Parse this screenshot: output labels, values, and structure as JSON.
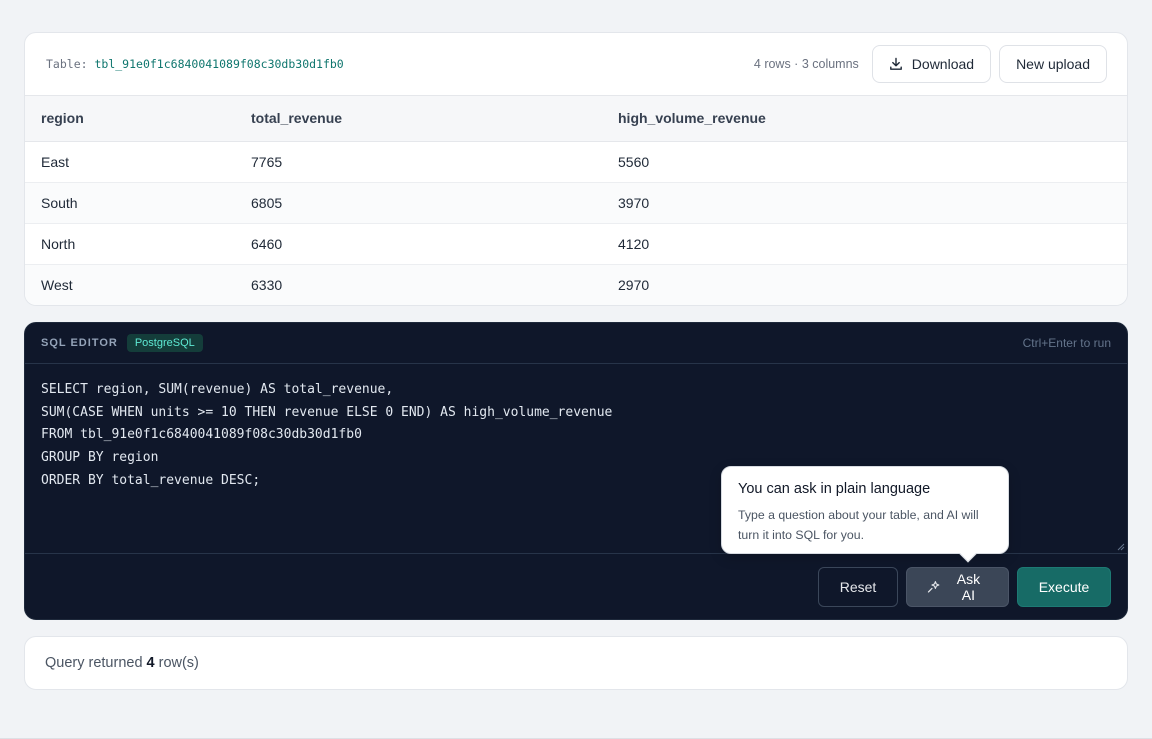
{
  "table_card": {
    "table_prefix": "Table:",
    "table_name": "tbl_91e0f1c6840041089f08c30db30d1fb0",
    "meta": "4 rows · 3 columns",
    "download_label": "Download",
    "new_upload_label": "New upload",
    "columns": [
      "region",
      "total_revenue",
      "high_volume_revenue"
    ],
    "rows": [
      [
        "East",
        "7765",
        "5560"
      ],
      [
        "South",
        "6805",
        "3970"
      ],
      [
        "North",
        "6460",
        "4120"
      ],
      [
        "West",
        "6330",
        "2970"
      ]
    ]
  },
  "editor": {
    "label": "SQL EDITOR",
    "dialect": "PostgreSQL",
    "hint": "Ctrl+Enter to run",
    "code": "SELECT region, SUM(revenue) AS total_revenue,\nSUM(CASE WHEN units >= 10 THEN revenue ELSE 0 END) AS high_volume_revenue\nFROM tbl_91e0f1c6840041089f08c30db30d1fb0\nGROUP BY region\nORDER BY total_revenue DESC;",
    "reset_label": "Reset",
    "ask_ai_label": "Ask AI",
    "execute_label": "Execute"
  },
  "tooltip": {
    "title": "You can ask in plain language",
    "body": "Type a question about your table, and AI will turn it into SQL for you."
  },
  "status": {
    "prefix": "Query returned",
    "count": "4",
    "suffix": "row(s)"
  },
  "icons": {
    "download": "download-icon",
    "sparkle": "sparkle-icon"
  },
  "colors": {
    "accent": "#176b66",
    "editor_bg": "#0f172a",
    "table_name": "#0f766e"
  }
}
